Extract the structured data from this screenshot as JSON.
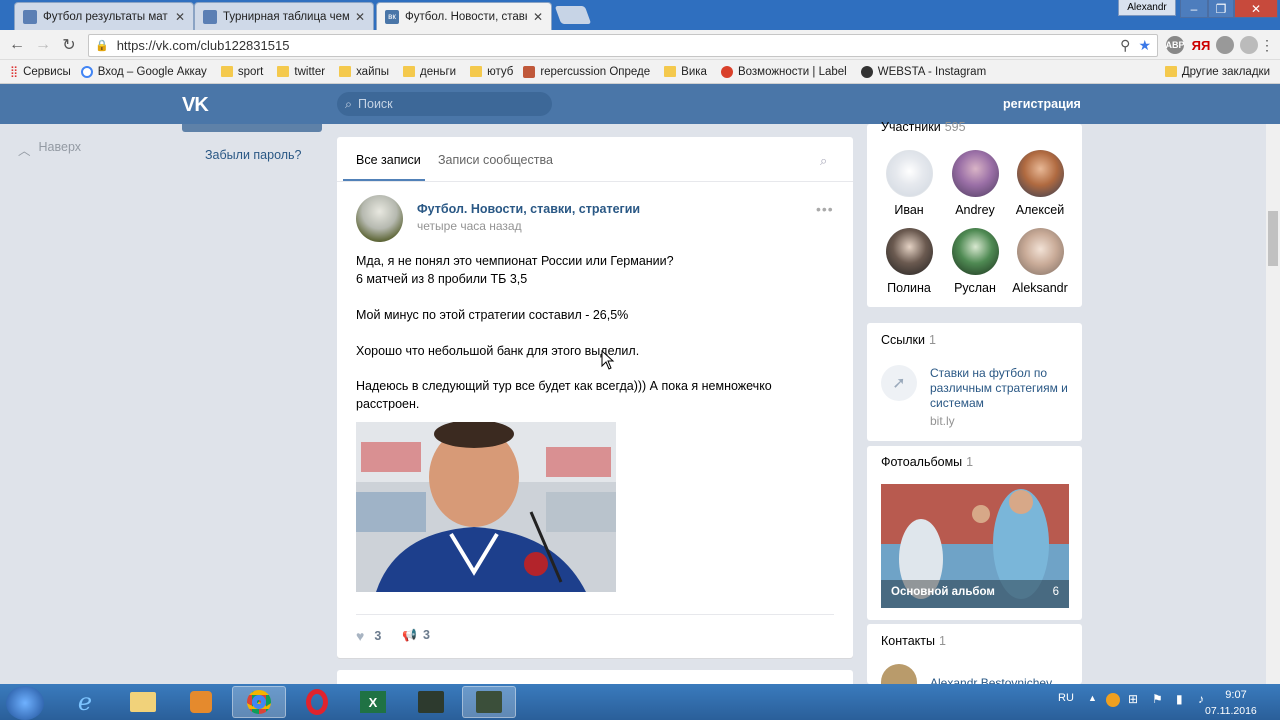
{
  "browser": {
    "tabs": [
      {
        "label": "Футбол результаты мат"
      },
      {
        "label": "Турнирная таблица чем"
      },
      {
        "label": "Футбол. Новости, ставк"
      }
    ],
    "user": "Alexandr",
    "url": "https://vk.com/club122831515",
    "bookmarks": [
      {
        "label": "Сервисы"
      },
      {
        "label": "Вход – Google Аккау"
      },
      {
        "label": "sport"
      },
      {
        "label": "twitter"
      },
      {
        "label": "хайпы"
      },
      {
        "label": "деньги"
      },
      {
        "label": "ютуб"
      },
      {
        "label": "repercussion Опреде"
      },
      {
        "label": "Вика"
      },
      {
        "label": "Возможности | Label"
      },
      {
        "label": "WEBSTA - Instagram"
      }
    ],
    "other_bookmarks": "Другие закладки",
    "extensions": [
      "ABP",
      "ЯЯ"
    ]
  },
  "vk": {
    "logo": "VK",
    "search_placeholder": "Поиск",
    "register": "регистрация",
    "up": "Наверх",
    "forgot_password": "Забыли пароль?"
  },
  "feed": {
    "tab_all": "Все записи",
    "tab_community": "Записи сообщества",
    "post": {
      "author": "Футбол. Новости, ставки, стратегии",
      "time": "четыре часа назад",
      "lines": [
        "Мда, я не понял это чемпионат России или Германии?",
        "6 матчей из 8 пробили ТБ 3,5",
        "Мой минус по этой стратегии составил - 26,5%",
        "Хорошо что небольшой банк для этого выделил.",
        "Надеюсь в следующий тур все будет как всегда))) А пока я немножечко расстроен."
      ],
      "likes": "3",
      "reposts": "3"
    }
  },
  "sidebar": {
    "members_title": "Участники",
    "members_count": "595",
    "members": [
      {
        "name": "Иван"
      },
      {
        "name": "Andrey"
      },
      {
        "name": "Алексей"
      },
      {
        "name": "Полина"
      },
      {
        "name": "Руслан"
      },
      {
        "name": "Aleksandr"
      }
    ],
    "links_title": "Ссылки",
    "links_count": "1",
    "link_text": "Ставки на футбол по различным стратегиям и системам",
    "link_domain": "bit.ly",
    "albums_title": "Фотоальбомы",
    "albums_count": "1",
    "album_name": "Основной альбом",
    "album_count": "6",
    "contacts_title": "Контакты",
    "contacts_count": "1",
    "contact_name": "Alexandr Bestovnichev"
  },
  "taskbar": {
    "lang": "RU",
    "time": "9:07",
    "date": "07.11.2016"
  }
}
